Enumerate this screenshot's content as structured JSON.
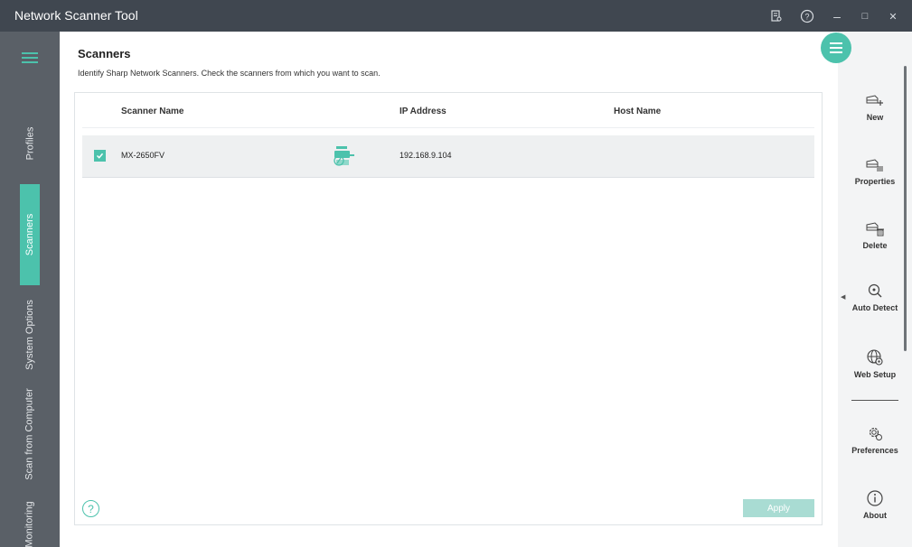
{
  "window": {
    "title": "Network Scanner Tool",
    "controls": {
      "minimize": "–",
      "maximize": "□",
      "close": "✕"
    }
  },
  "leftnav": {
    "tabs": [
      {
        "label": "Profiles",
        "active": false
      },
      {
        "label": "Scanners",
        "active": true
      },
      {
        "label": "System Options",
        "active": false
      },
      {
        "label": "Scan from Computer",
        "active": false
      },
      {
        "label": "Monitoring",
        "active": false
      }
    ]
  },
  "main": {
    "title": "Scanners",
    "description": "Identify Sharp Network Scanners. Check the scanners from which you want to scan.",
    "table": {
      "headers": {
        "name": "Scanner Name",
        "ip": "IP Address",
        "host": "Host Name"
      },
      "rows": [
        {
          "checked": true,
          "name": "MX-2650FV",
          "ip": "192.168.9.104",
          "host": ""
        }
      ]
    },
    "help_glyph": "?",
    "apply_label": "Apply"
  },
  "actions": {
    "new": "New",
    "properties": "Properties",
    "delete": "Delete",
    "auto_detect": "Auto Detect",
    "web_setup": "Web Setup",
    "preferences": "Preferences",
    "about": "About"
  },
  "colors": {
    "accent": "#4cc2ac",
    "titlebar": "#404750",
    "sidebar": "#5a6067",
    "right_panel": "#f3f4f5"
  }
}
